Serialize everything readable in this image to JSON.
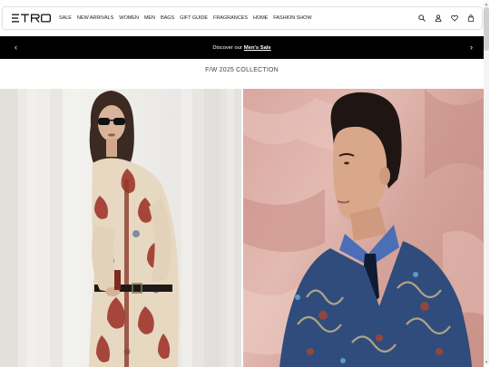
{
  "brand": {
    "logo_text": "ETRO"
  },
  "nav": {
    "items": [
      "SALE",
      "NEW ARRIVALS",
      "WOMEN",
      "MEN",
      "BAGS",
      "GIFT GUIDE",
      "FRAGRANCES",
      "HOME",
      "FASHION SHOW"
    ]
  },
  "header_icons": [
    "search-icon",
    "account-icon",
    "wishlist-icon",
    "bag-icon"
  ],
  "promo": {
    "text": "Discover our",
    "link": "Men's Sale",
    "prev_arrow": "‹",
    "next_arrow": "›"
  },
  "collection": {
    "title": "F/W 2025 COLLECTION"
  },
  "colors": {
    "promo_bg": "#000000",
    "promo_text": "#ffffff",
    "page_bg": "#ffffff",
    "right_backdrop": "#d9a79f",
    "left_backdrop": "#eeede9"
  }
}
